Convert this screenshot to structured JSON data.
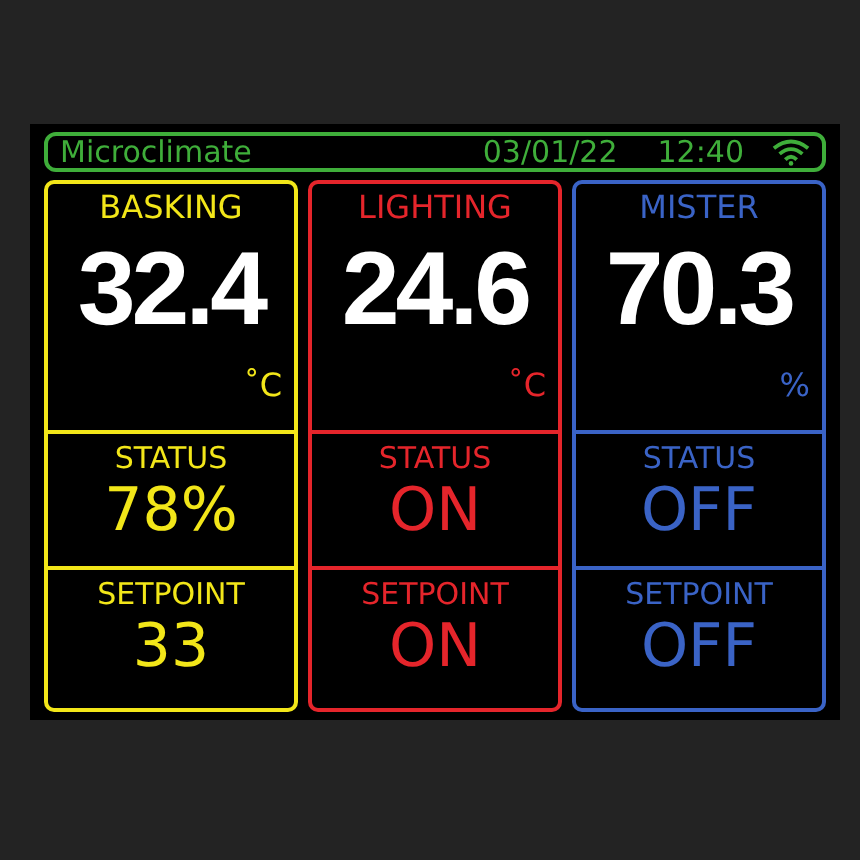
{
  "header": {
    "title": "Microclimate",
    "date": "03/01/22",
    "time": "12:40"
  },
  "panels": [
    {
      "name": "BASKING",
      "color": "#f2e619",
      "value": "32.4",
      "unit": "˚C",
      "status_label": "STATUS",
      "status": "78%",
      "setpoint_label": "SETPOINT",
      "setpoint": "33"
    },
    {
      "name": "LIGHTING",
      "color": "#e5252b",
      "value": "24.6",
      "unit": "˚C",
      "status_label": "STATUS",
      "status": "ON",
      "setpoint_label": "SETPOINT",
      "setpoint": "ON"
    },
    {
      "name": "MISTER",
      "color": "#3a63c6",
      "value": "70.3",
      "unit": "%",
      "status_label": "STATUS",
      "status": "OFF",
      "setpoint_label": "SETPOINT",
      "setpoint": "OFF"
    }
  ]
}
